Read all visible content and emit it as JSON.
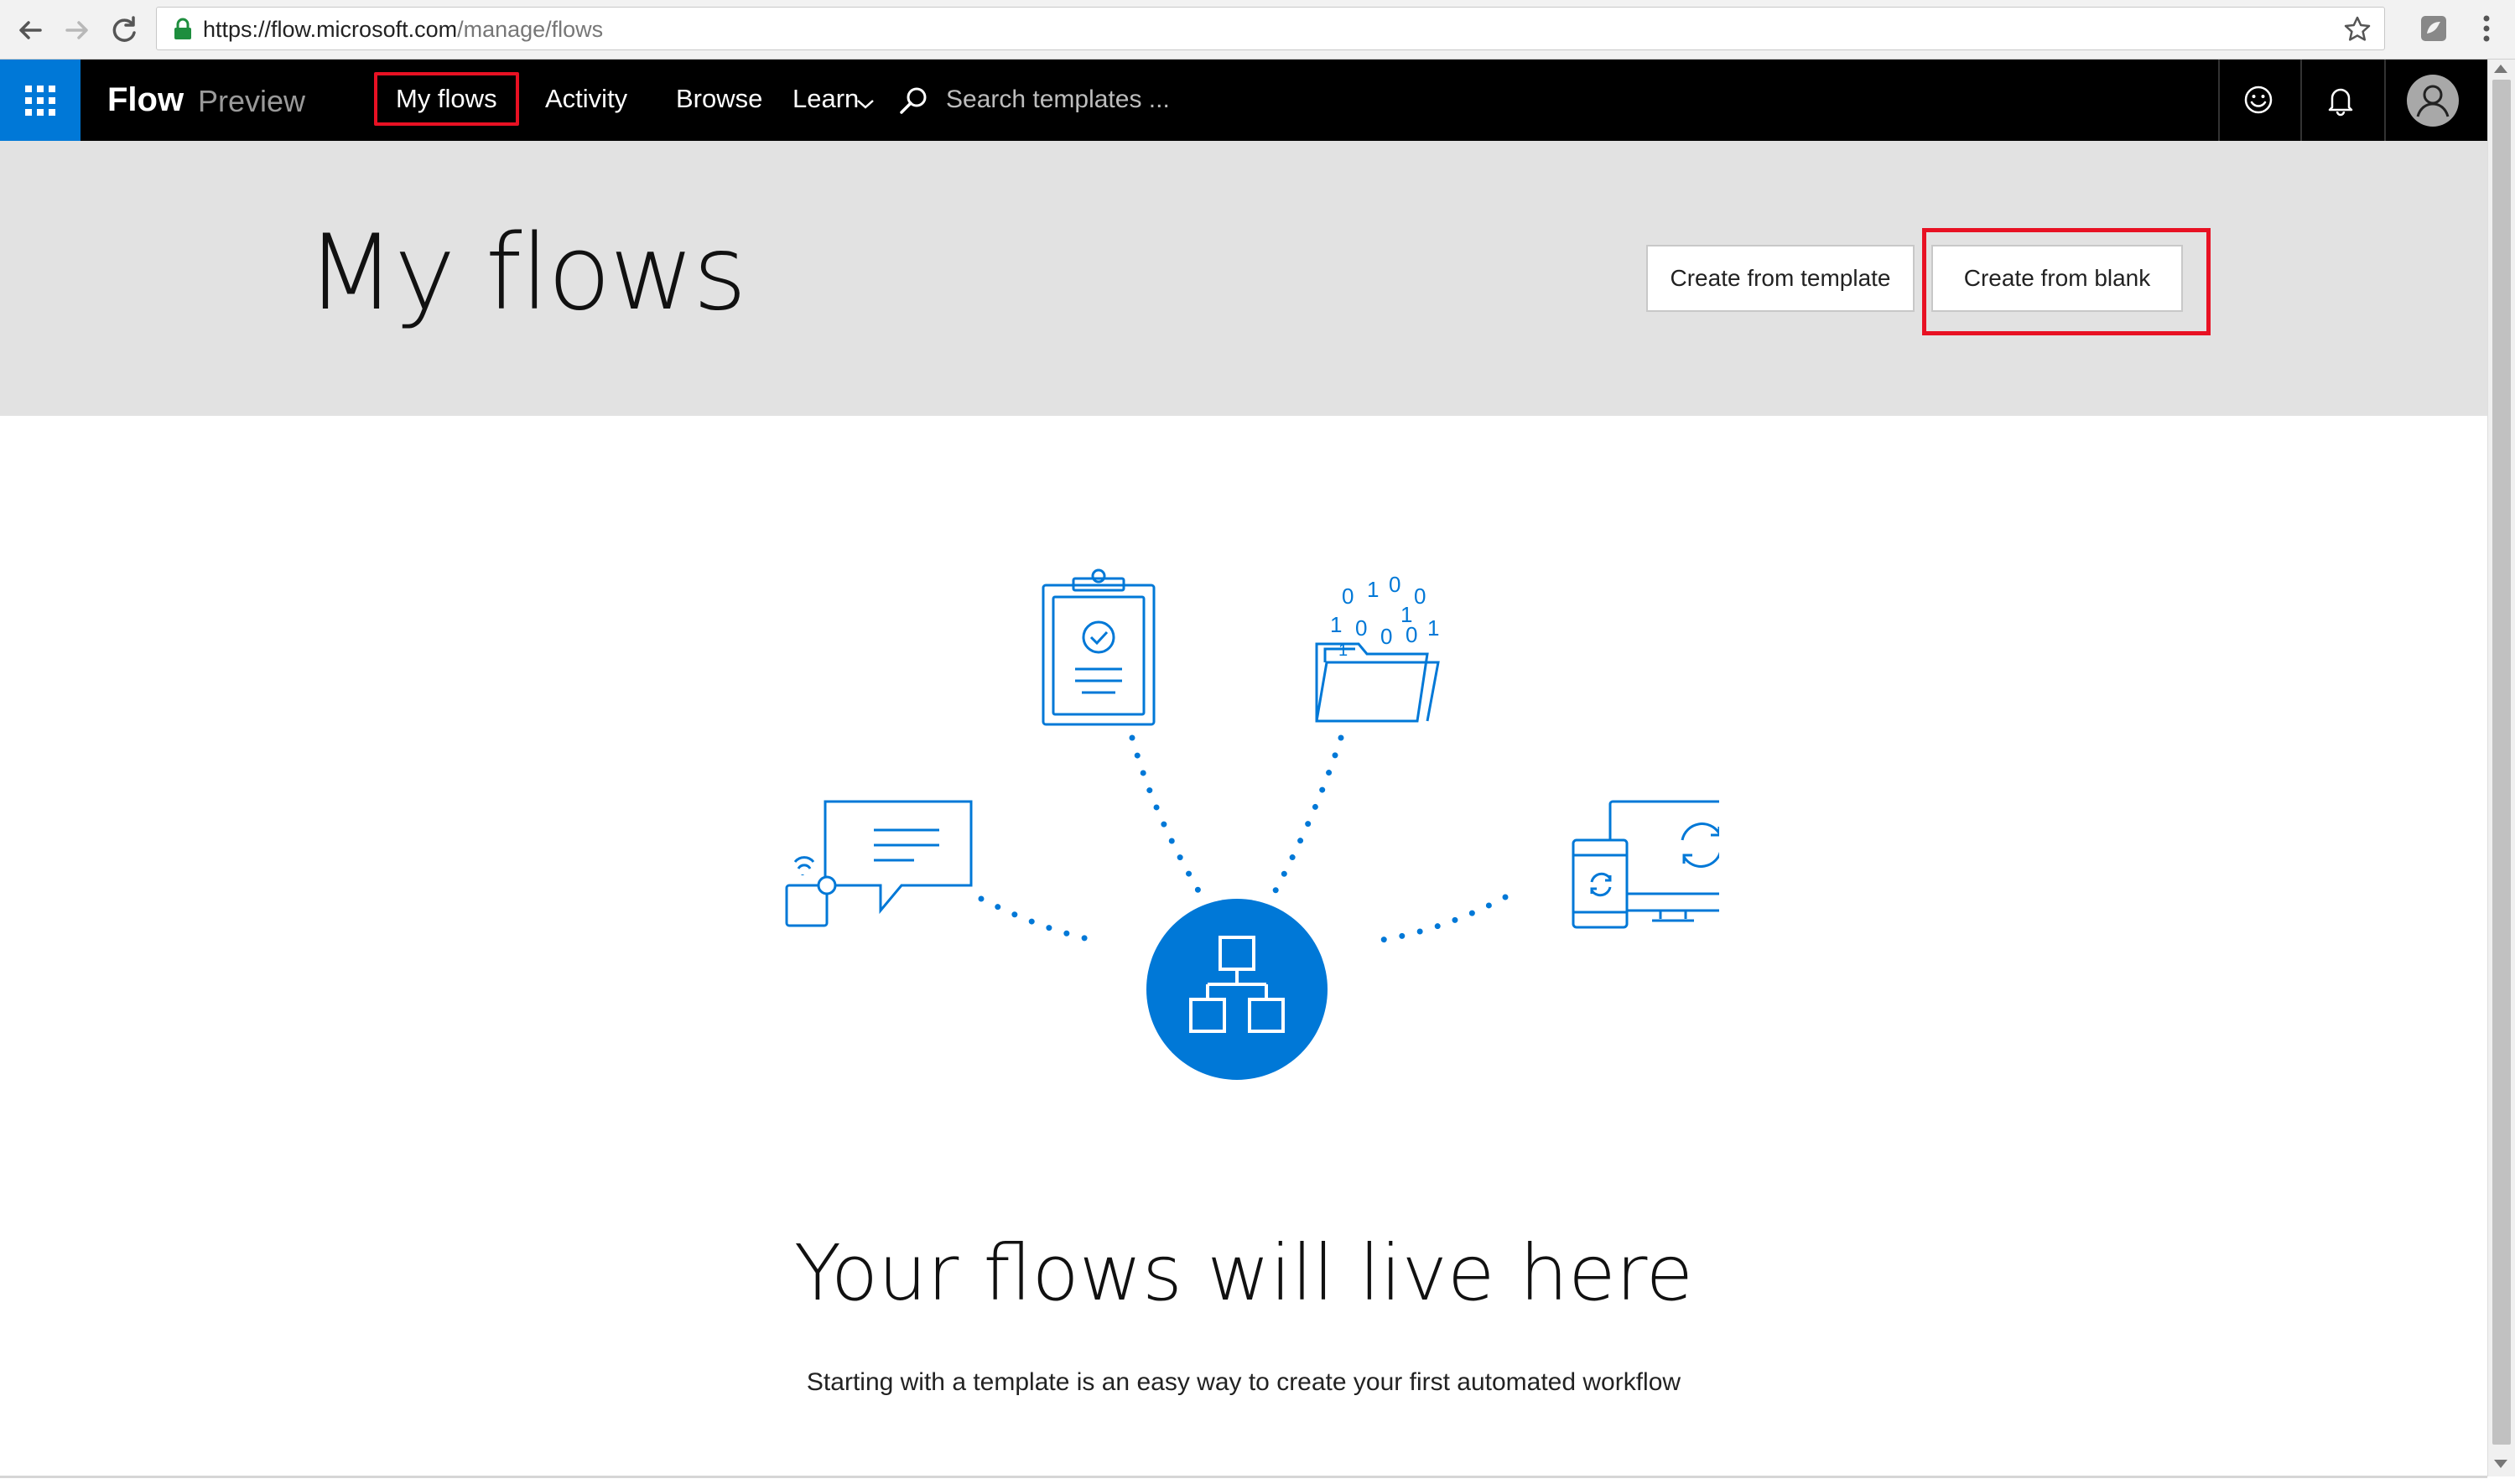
{
  "browser": {
    "url_host": "https://flow.microsoft.com",
    "url_path": "/manage/flows"
  },
  "header": {
    "brand": "Flow",
    "brand_sub": "Preview",
    "nav": {
      "my_flows": "My flows",
      "activity": "Activity",
      "browse": "Browse",
      "learn": "Learn"
    },
    "search_placeholder": "Search templates ..."
  },
  "hero": {
    "title": "My flows",
    "create_from_template": "Create from template",
    "create_from_blank": "Create from blank"
  },
  "empty_state": {
    "title": "Your flows will live here",
    "subtitle": "Starting with a template is an easy way to create your first automated workflow",
    "binary_digits": [
      "0",
      "1",
      "0",
      "0",
      "1",
      "0",
      "0",
      "0",
      "1",
      "1"
    ]
  },
  "colors": {
    "accent": "#0078d7",
    "highlight": "#e81123",
    "header_bg": "#000000",
    "hero_bg": "#e2e2e2"
  },
  "icons": {
    "back": "back-arrow-icon",
    "forward": "forward-arrow-icon",
    "reload": "reload-icon",
    "lock": "lock-icon",
    "bookmark": "star-icon",
    "waffle": "app-launcher-icon",
    "search": "search-icon",
    "feedback": "smiley-icon",
    "notifications": "bell-icon",
    "profile": "avatar-icon"
  }
}
